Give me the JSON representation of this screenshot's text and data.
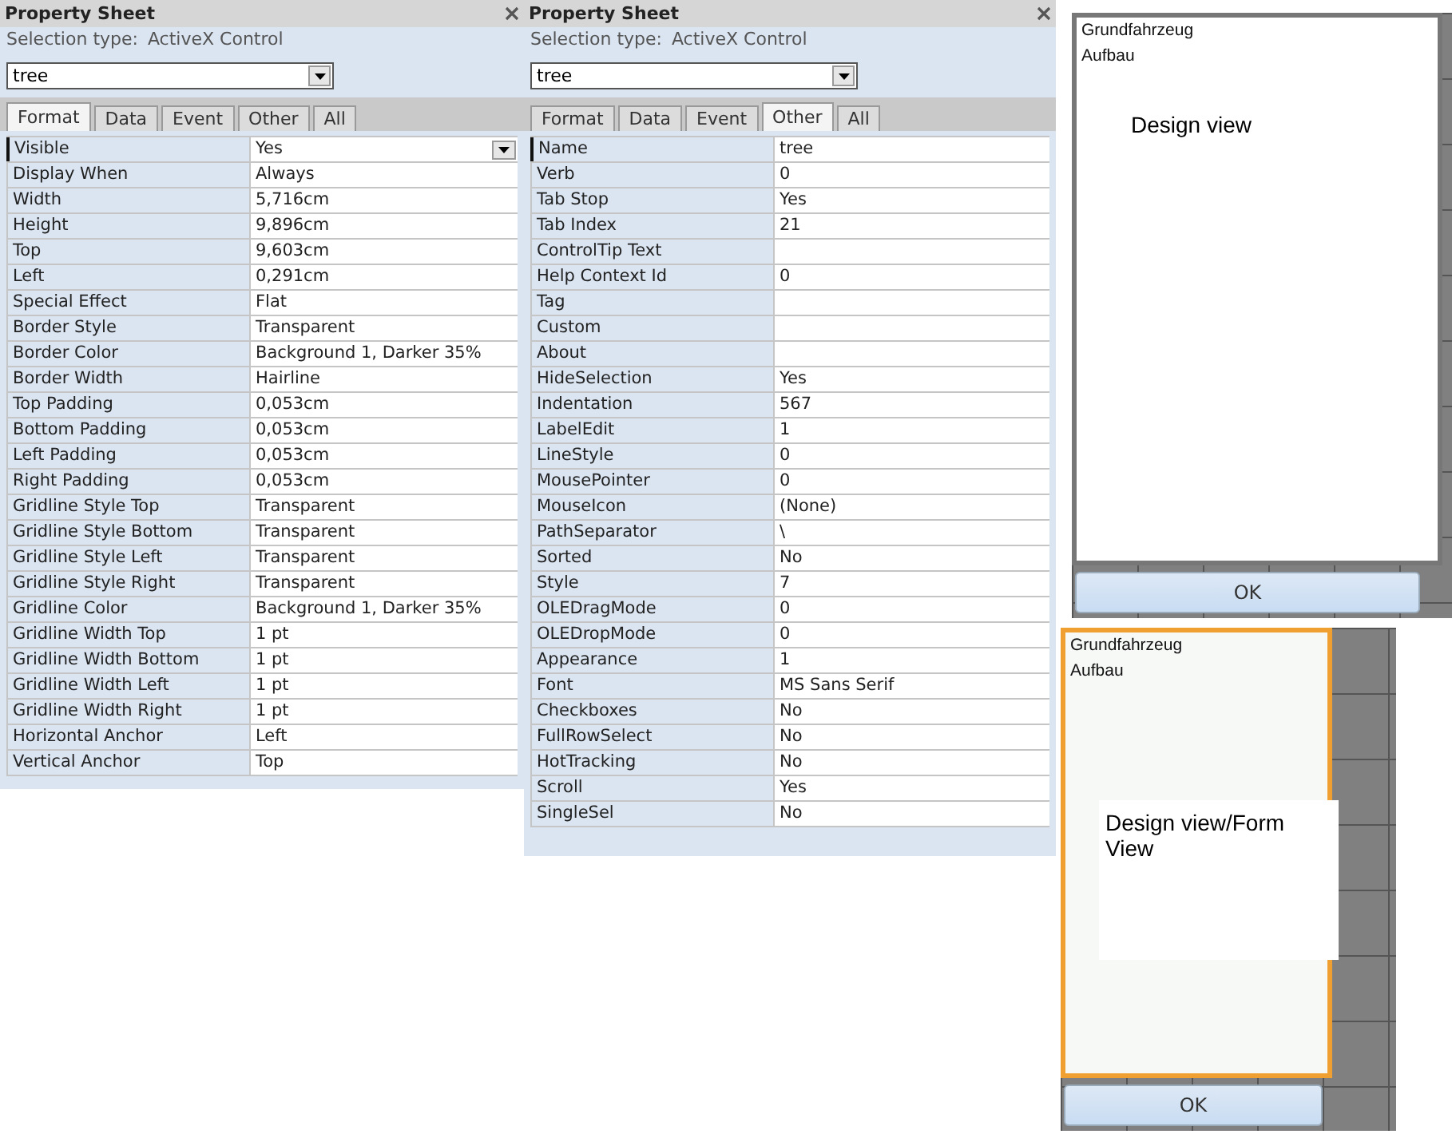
{
  "sheets": [
    {
      "title": "Property Sheet",
      "selection_label": "Selection type:",
      "selection_type": "ActiveX Control",
      "object": "tree",
      "tabs": [
        {
          "label": "Format",
          "selected": true
        },
        {
          "label": "Data",
          "selected": false
        },
        {
          "label": "Event",
          "selected": false
        },
        {
          "label": "Other",
          "selected": false
        },
        {
          "label": "All",
          "selected": false
        }
      ],
      "properties": [
        {
          "name": "Visible",
          "value": "Yes",
          "selected": true,
          "dropdown": true
        },
        {
          "name": "Display When",
          "value": "Always",
          "selected": false
        },
        {
          "name": "Width",
          "value": "5,716cm",
          "selected": false
        },
        {
          "name": "Height",
          "value": "9,896cm",
          "selected": false
        },
        {
          "name": "Top",
          "value": "9,603cm",
          "selected": false
        },
        {
          "name": "Left",
          "value": "0,291cm",
          "selected": false
        },
        {
          "name": "Special Effect",
          "value": "Flat",
          "selected": false
        },
        {
          "name": "Border Style",
          "value": "Transparent",
          "selected": false
        },
        {
          "name": "Border Color",
          "value": "Background 1, Darker 35%",
          "selected": false
        },
        {
          "name": "Border Width",
          "value": "Hairline",
          "selected": false
        },
        {
          "name": "Top Padding",
          "value": "0,053cm",
          "selected": false
        },
        {
          "name": "Bottom Padding",
          "value": "0,053cm",
          "selected": false
        },
        {
          "name": "Left Padding",
          "value": "0,053cm",
          "selected": false
        },
        {
          "name": "Right Padding",
          "value": "0,053cm",
          "selected": false
        },
        {
          "name": "Gridline Style Top",
          "value": "Transparent",
          "selected": false
        },
        {
          "name": "Gridline Style Bottom",
          "value": "Transparent",
          "selected": false
        },
        {
          "name": "Gridline Style Left",
          "value": "Transparent",
          "selected": false
        },
        {
          "name": "Gridline Style Right",
          "value": "Transparent",
          "selected": false
        },
        {
          "name": "Gridline Color",
          "value": "Background 1, Darker 35%",
          "selected": false
        },
        {
          "name": "Gridline Width Top",
          "value": "1 pt",
          "selected": false
        },
        {
          "name": "Gridline Width Bottom",
          "value": "1 pt",
          "selected": false
        },
        {
          "name": "Gridline Width Left",
          "value": "1 pt",
          "selected": false
        },
        {
          "name": "Gridline Width Right",
          "value": "1 pt",
          "selected": false
        },
        {
          "name": "Horizontal Anchor",
          "value": "Left",
          "selected": false
        },
        {
          "name": "Vertical Anchor",
          "value": "Top",
          "selected": false
        }
      ]
    },
    {
      "title": "Property Sheet",
      "selection_label": "Selection type:",
      "selection_type": "ActiveX Control",
      "object": "tree",
      "tabs": [
        {
          "label": "Format",
          "selected": false
        },
        {
          "label": "Data",
          "selected": false
        },
        {
          "label": "Event",
          "selected": false
        },
        {
          "label": "Other",
          "selected": true
        },
        {
          "label": "All",
          "selected": false
        }
      ],
      "properties": [
        {
          "name": "Name",
          "value": "tree",
          "selected": true
        },
        {
          "name": "Verb",
          "value": "0",
          "selected": false
        },
        {
          "name": "Tab Stop",
          "value": "Yes",
          "selected": false
        },
        {
          "name": "Tab Index",
          "value": "21",
          "selected": false
        },
        {
          "name": "ControlTip Text",
          "selected": false
        },
        {
          "name": "Help Context Id",
          "value": "0",
          "selected": false
        },
        {
          "name": "Tag",
          "selected": false
        },
        {
          "name": "Custom",
          "selected": false
        },
        {
          "name": "About",
          "selected": false
        },
        {
          "name": "HideSelection",
          "value": "Yes",
          "selected": false
        },
        {
          "name": "Indentation",
          "value": "567",
          "selected": false
        },
        {
          "name": "LabelEdit",
          "value": "1",
          "selected": false
        },
        {
          "name": "LineStyle",
          "value": "0",
          "selected": false
        },
        {
          "name": "MousePointer",
          "value": "0",
          "selected": false
        },
        {
          "name": "MouseIcon",
          "value": "(None)",
          "selected": false
        },
        {
          "name": "PathSeparator",
          "value": "\\",
          "selected": false
        },
        {
          "name": "Sorted",
          "value": "No",
          "selected": false
        },
        {
          "name": "Style",
          "value": "7",
          "selected": false
        },
        {
          "name": "OLEDragMode",
          "value": "0",
          "selected": false
        },
        {
          "name": "OLEDropMode",
          "value": "0",
          "selected": false
        },
        {
          "name": "Appearance",
          "value": "1",
          "selected": false
        },
        {
          "name": "Font",
          "value": "MS Sans Serif",
          "selected": false
        },
        {
          "name": "Checkboxes",
          "value": "No",
          "selected": false
        },
        {
          "name": "FullRowSelect",
          "value": "No",
          "selected": false
        },
        {
          "name": "HotTracking",
          "value": "No",
          "selected": false
        },
        {
          "name": "Scroll",
          "value": "Yes",
          "selected": false
        },
        {
          "name": "SingleSel",
          "value": "No",
          "selected": false
        }
      ]
    }
  ],
  "previews": [
    {
      "nodes": [
        "Grundfahrzeug",
        "Aufbau"
      ],
      "note": "Design view",
      "selected": false,
      "button": "OK"
    },
    {
      "nodes": [
        "Grundfahrzeug",
        "Aufbau"
      ],
      "note": "Design view/Form View",
      "selected": true,
      "button": "OK"
    }
  ]
}
